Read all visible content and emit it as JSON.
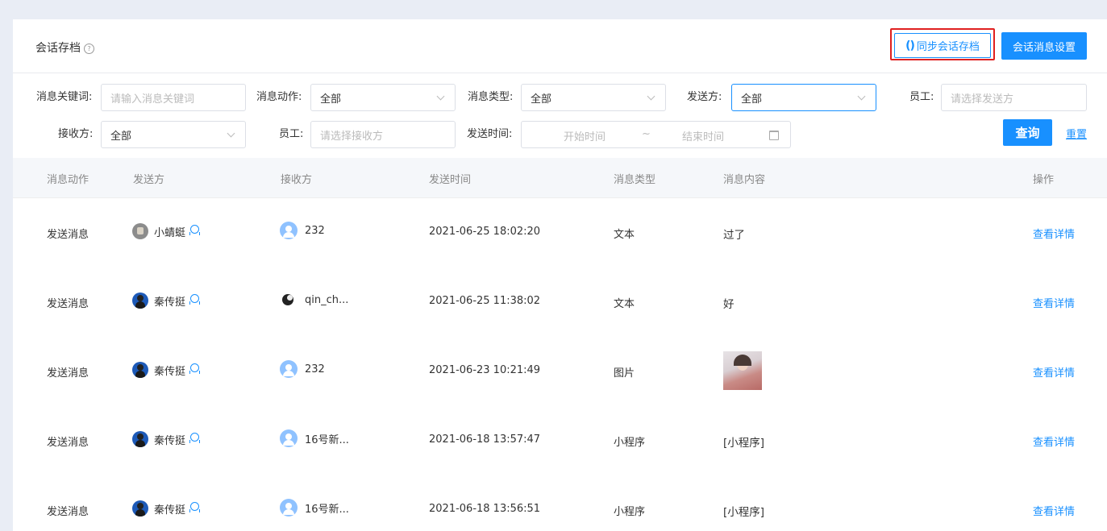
{
  "header": {
    "title": "会话存档",
    "help_icon": "?",
    "sync_button": "同步会话存档",
    "settings_button": "会话消息设置"
  },
  "filters": {
    "keyword": {
      "label": "消息关键词:",
      "placeholder": "请输入消息关键词"
    },
    "action": {
      "label": "消息动作:",
      "value": "全部"
    },
    "type": {
      "label": "消息类型:",
      "value": "全部"
    },
    "sender": {
      "label": "发送方:",
      "value": "全部"
    },
    "sender_employee": {
      "label": "员工:",
      "placeholder": "请选择发送方"
    },
    "receiver": {
      "label": "接收方:",
      "value": "全部"
    },
    "receiver_employee": {
      "label": "员工:",
      "placeholder": "请选择接收方"
    },
    "send_time": {
      "label": "发送时间:",
      "start_placeholder": "开始时间",
      "separator": "~",
      "end_placeholder": "结束时间"
    },
    "query_button": "查询",
    "reset_link": "重置"
  },
  "table": {
    "columns": [
      "消息动作",
      "发送方",
      "接收方",
      "发送时间",
      "消息类型",
      "消息内容",
      "操作"
    ],
    "rows": [
      {
        "action": "发送消息",
        "sender": "小蜻蜓",
        "receiver": "232",
        "time": "2021-06-25 18:02:20",
        "type": "文本",
        "content": "过了",
        "op": "查看详情"
      },
      {
        "action": "发送消息",
        "sender": "秦传挺",
        "receiver": "qin_ch...",
        "time": "2021-06-25 11:38:02",
        "type": "文本",
        "content": "好",
        "op": "查看详情"
      },
      {
        "action": "发送消息",
        "sender": "秦传挺",
        "receiver": "232",
        "time": "2021-06-23 10:21:49",
        "type": "图片",
        "content": "",
        "op": "查看详情"
      },
      {
        "action": "发送消息",
        "sender": "秦传挺",
        "receiver": "16号新...",
        "time": "2021-06-18 13:57:47",
        "type": "小程序",
        "content": "[小程序]",
        "op": "查看详情"
      },
      {
        "action": "发送消息",
        "sender": "秦传挺",
        "receiver": "16号新...",
        "time": "2021-06-18 13:56:51",
        "type": "小程序",
        "content": "[小程序]",
        "op": "查看详情"
      }
    ]
  },
  "colors": {
    "primary": "#1890ff",
    "highlight": "#e02020"
  }
}
